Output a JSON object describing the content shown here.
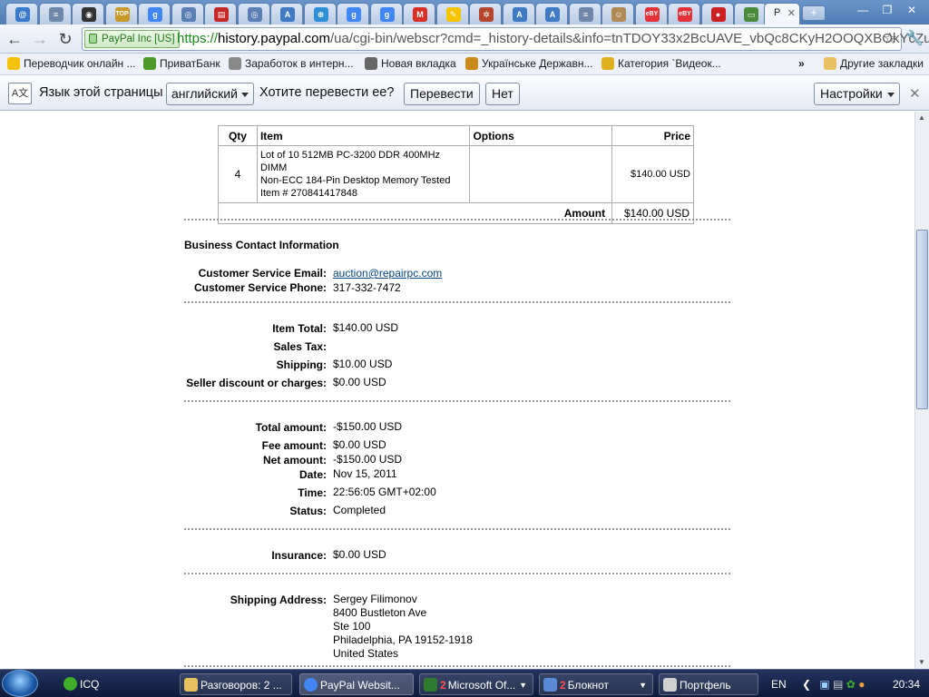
{
  "tabs": {
    "favicons": [
      {
        "name": "mail-icon",
        "color": "#3a78c9",
        "glyph": "@"
      },
      {
        "name": "doc-icon",
        "color": "#6f87a8",
        "glyph": "≡"
      },
      {
        "name": "camera-icon",
        "color": "#333333",
        "glyph": "◉"
      },
      {
        "name": "top100-icon",
        "color": "#c89a2a",
        "glyph": "TOP"
      },
      {
        "name": "google-icon",
        "color": "#4285f4",
        "glyph": "g"
      },
      {
        "name": "globe-icon",
        "color": "#5b7fb3",
        "glyph": "◎"
      },
      {
        "name": "pdf-icon",
        "color": "#c62828",
        "glyph": "▤"
      },
      {
        "name": "globe-icon",
        "color": "#5b7fb3",
        "glyph": "◎"
      },
      {
        "name": "translate-icon",
        "color": "#3f7ac2",
        "glyph": "A"
      },
      {
        "name": "browser-icon",
        "color": "#2f8fd6",
        "glyph": "⊕"
      },
      {
        "name": "google-icon",
        "color": "#4285f4",
        "glyph": "g"
      },
      {
        "name": "google-icon",
        "color": "#4285f4",
        "glyph": "g"
      },
      {
        "name": "gmail-icon",
        "color": "#d93025",
        "glyph": "M"
      },
      {
        "name": "sticky-icon",
        "color": "#f5c300",
        "glyph": "✎"
      },
      {
        "name": "helm-icon",
        "color": "#b5472d",
        "glyph": "✲"
      },
      {
        "name": "translate-icon",
        "color": "#3f7ac2",
        "glyph": "A"
      },
      {
        "name": "translate-icon",
        "color": "#3f7ac2",
        "glyph": "A"
      },
      {
        "name": "doc-icon",
        "color": "#6f87a8",
        "glyph": "≡"
      },
      {
        "name": "user-icon",
        "color": "#b08a55",
        "glyph": "☺"
      },
      {
        "name": "ebay-icon",
        "color": "#e53238",
        "glyph": "eBY"
      },
      {
        "name": "ebay-icon",
        "color": "#e53238",
        "glyph": "eBY"
      },
      {
        "name": "news-icon",
        "color": "#cc2222",
        "glyph": "●"
      },
      {
        "name": "image-icon",
        "color": "#4a8a3a",
        "glyph": "▭"
      }
    ],
    "active_label": "P"
  },
  "toolbar": {
    "ev_label": "PayPal Inc [US]",
    "url_scheme": "https://",
    "url_host": "history.paypal.com",
    "url_path": "/ua/cgi-bin/webscr?cmd=_history-details&info=tnTDOY33x2BcUAVE_vbQc8CKyH2OOQXBOkYcZu"
  },
  "bookmarks": [
    {
      "label": "Переводчик онлайн ...",
      "color": "#f4c20d"
    },
    {
      "label": "ПриватБанк",
      "color": "#4d9a2a"
    },
    {
      "label": "Заработок в интерн...",
      "color": "#888888"
    },
    {
      "label": "Новая вкладка",
      "color": "#666666"
    },
    {
      "label": "Українське Державн...",
      "color": "#c98a1b"
    },
    {
      "label": "Категория `Видеок...",
      "color": "#e0b020"
    },
    {
      "label": "Другие закладки",
      "color": "#e8c060"
    }
  ],
  "infobar": {
    "icon_glyph": "A文",
    "prompt": "Язык этой страницы",
    "language": "английский",
    "question": "Хотите перевести ее?",
    "translate_btn": "Перевести",
    "no_btn": "Нет",
    "settings_btn": "Настройки"
  },
  "items_table": {
    "headers": {
      "qty": "Qty",
      "item": "Item",
      "options": "Options",
      "price": "Price"
    },
    "rows": [
      {
        "qty": "4",
        "item_line1": "Lot of 10 512MB PC-3200 DDR 400MHz DIMM",
        "item_line2": "Non-ECC 184-Pin Desktop Memory Tested",
        "item_line3": "Item # 270841417848",
        "options": "",
        "price": "$140.00 USD"
      }
    ],
    "amount_label": "Amount",
    "amount_value": "$140.00 USD"
  },
  "business_contact": {
    "title": "Business Contact Information",
    "email_label": "Customer Service Email:",
    "email_value": "auction@repairpc.com",
    "phone_label": "Customer Service Phone:",
    "phone_value": "317-332-7472"
  },
  "totals": {
    "item_total_label": "Item Total:",
    "item_total_value": "$140.00 USD",
    "sales_tax_label": "Sales Tax:",
    "sales_tax_value": "",
    "shipping_label": "Shipping:",
    "shipping_value": "$10.00 USD",
    "discount_label": "Seller discount or charges:",
    "discount_value": "$0.00 USD"
  },
  "payment": {
    "total_label": "Total amount:",
    "total_value": "-$150.00 USD",
    "fee_label": "Fee amount:",
    "fee_value": "$0.00 USD",
    "net_label": "Net amount:",
    "net_value": "-$150.00 USD",
    "date_label": "Date:",
    "date_value": "Nov 15, 2011",
    "time_label": "Time:",
    "time_value": "22:56:05 GMT+02:00",
    "status_label": "Status:",
    "status_value": "Completed"
  },
  "insurance": {
    "label": "Insurance:",
    "value": "$0.00 USD"
  },
  "shipping_address": {
    "label": "Shipping Address:",
    "line1": "Sergey Filimonov",
    "line2": "8400 Bustleton Ave",
    "line3": "Ste 100",
    "line4": "Philadelphia, PA 19152-1918",
    "line5": "United States"
  },
  "taskbar": {
    "items": [
      {
        "label": "ICQ",
        "count": "",
        "color": "#3fae2a"
      },
      {
        "label": "Разговоров: 2 ...",
        "count": "",
        "color": "#e8c060"
      },
      {
        "label": "PayPal Websit...",
        "count": "",
        "color": "#4285f4"
      },
      {
        "label": "Microsoft Of...",
        "count": "2",
        "color": "#2f7a2f"
      },
      {
        "label": "Блокнот",
        "count": "2",
        "color": "#5a8ad6"
      },
      {
        "label": "Портфель",
        "count": "",
        "color": "#d0d0d0"
      }
    ],
    "lang": "EN",
    "clock": "20:34"
  }
}
